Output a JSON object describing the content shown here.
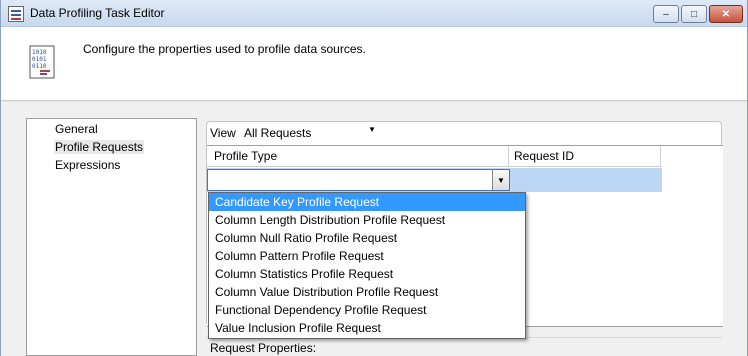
{
  "window": {
    "title": "Data Profiling Task Editor",
    "controls": [
      "minimize",
      "maximize",
      "close"
    ]
  },
  "header": {
    "description": "Configure the properties used to profile data sources."
  },
  "nav": {
    "items": [
      {
        "label": "General"
      },
      {
        "label": "Profile Requests"
      },
      {
        "label": "Expressions"
      }
    ]
  },
  "main": {
    "view_label": "View",
    "view_value": "All Requests",
    "grid": {
      "columns": [
        "Profile Type",
        "Request ID"
      ]
    },
    "dropdown": {
      "options": [
        "Candidate Key Profile Request",
        "Column Length Distribution Profile Request",
        "Column Null Ratio Profile Request",
        "Column Pattern Profile Request",
        "Column Statistics Profile Request",
        "Column Value Distribution Profile Request",
        "Functional Dependency Profile Request",
        "Value Inclusion Profile Request"
      ],
      "selected_index": 0
    },
    "request_properties_label": "Request Properties:"
  },
  "colors": {
    "selection": "#3399ff",
    "row_highlight": "#bcd6f5",
    "title_bg": "#dde9f7"
  }
}
